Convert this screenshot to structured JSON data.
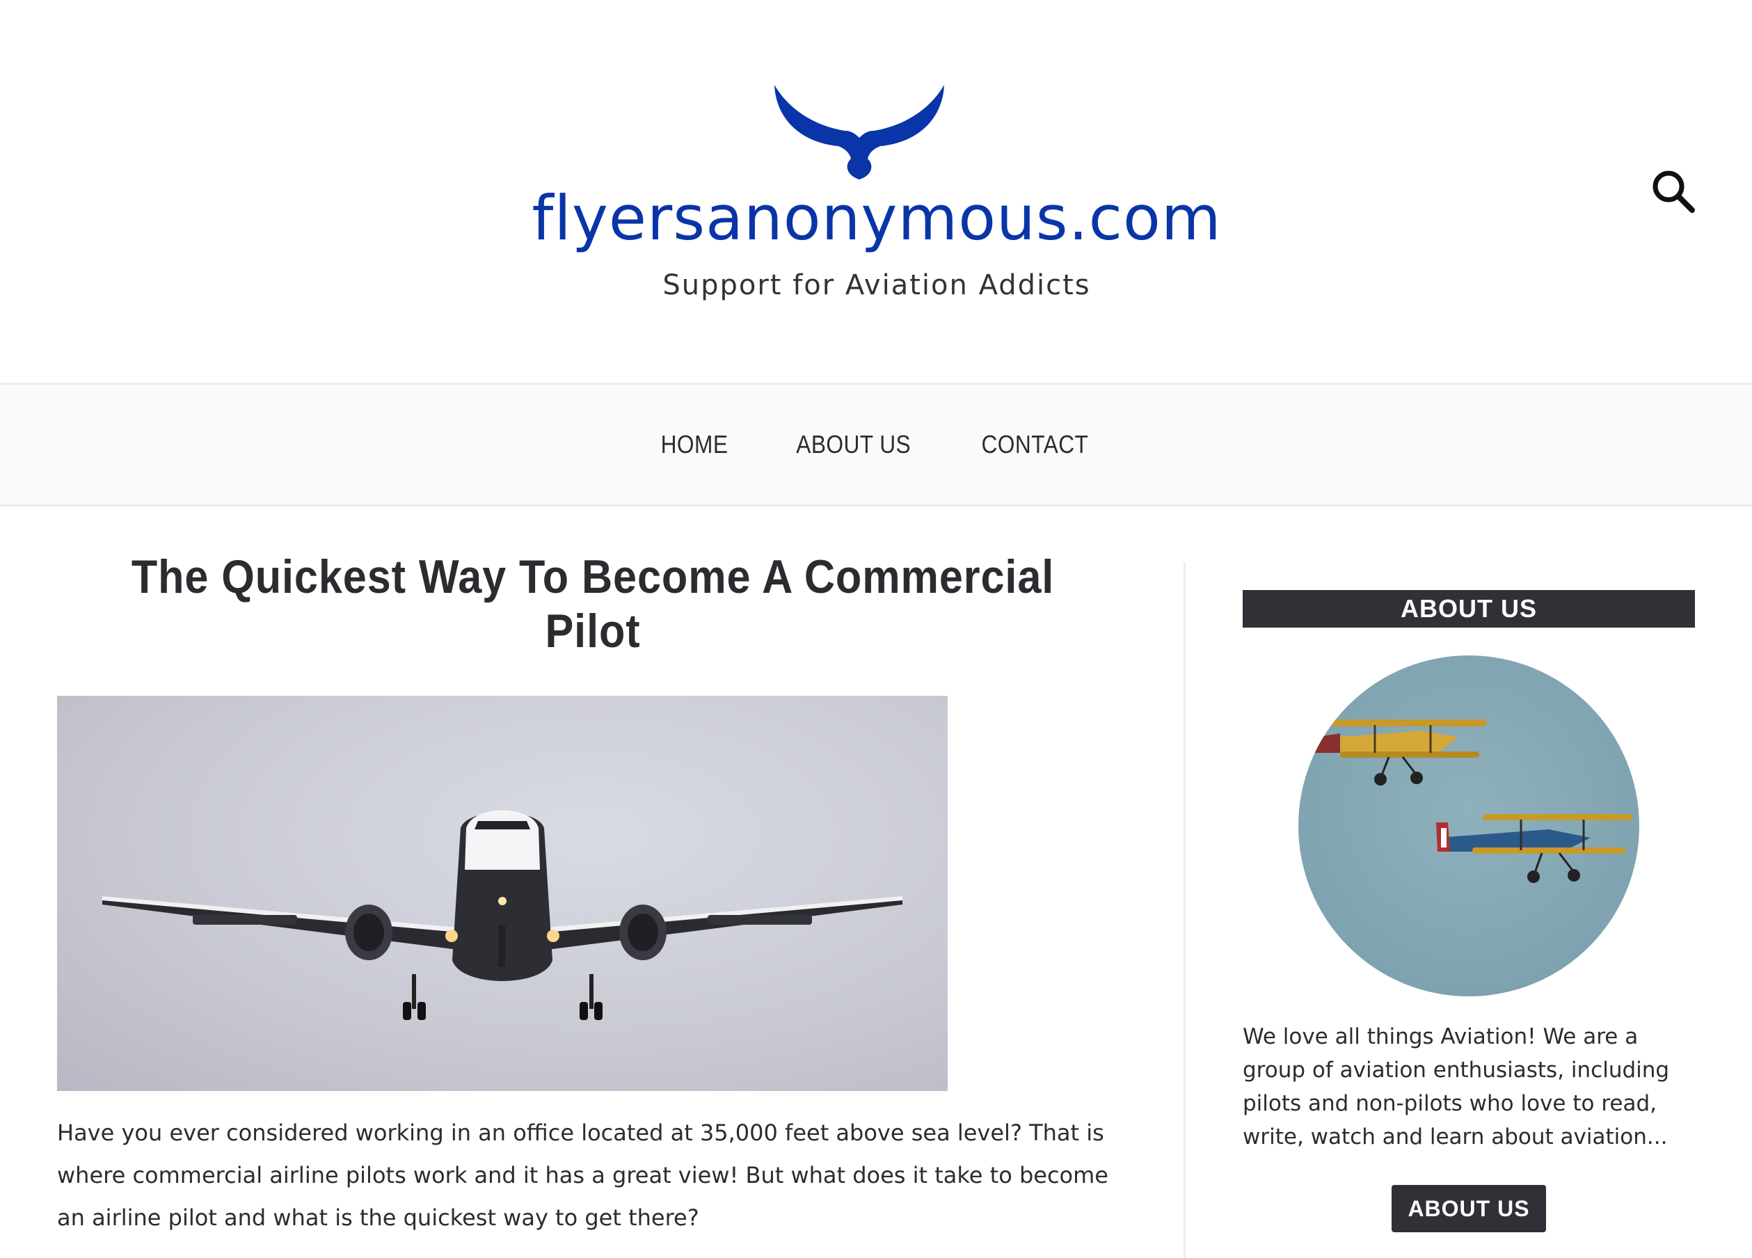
{
  "header": {
    "logo_wordmark": "flyersanonymous.com",
    "logo_tagline": "Support for Aviation Addicts",
    "brand_color": "#0a35a8",
    "search_icon": "search-icon"
  },
  "nav": {
    "items": [
      {
        "label": "HOME"
      },
      {
        "label": "ABOUT US"
      },
      {
        "label": "CONTACT"
      }
    ]
  },
  "post": {
    "title": "The Quickest Way To Become A Commercial Pilot",
    "image_subject": "airplane",
    "excerpt": "Have you ever considered working in an office located at 35,000 feet above sea level? That is where commercial airline pilots work and it has a great view! But what does it take to become an airline pilot and what is the quickest way to get there?"
  },
  "sidebar": {
    "widget_title": "ABOUT US",
    "widget_image_subject": "biplanes",
    "widget_text": "We love all things Aviation! We are a group of aviation enthusiasts, including pilots and non-pilots who love to read, write, watch and learn about aviation...",
    "button_label": "ABOUT US",
    "accent_color": "#2f3137"
  }
}
